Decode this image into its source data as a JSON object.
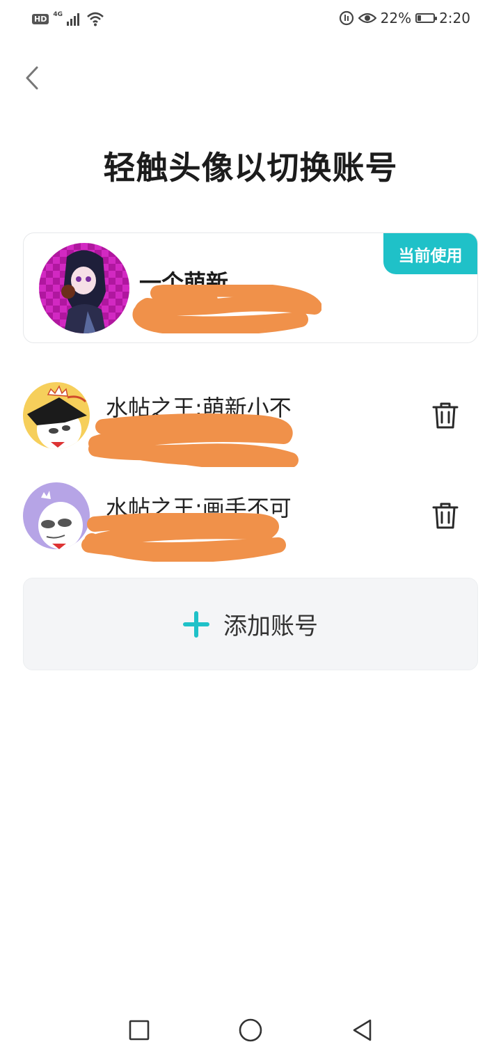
{
  "status_bar": {
    "hd_label": "HD",
    "network_label": "4G",
    "battery_text": "22%",
    "battery_level": 0.22,
    "time": "2:20"
  },
  "header": {
    "title": "轻触头像以切换账号"
  },
  "current_account": {
    "name": "一个萌新",
    "badge_label": "当前使用"
  },
  "accounts": [
    {
      "name": "水帖之王:萌新小不"
    },
    {
      "name": "水帖之王:画手不可"
    }
  ],
  "add_account": {
    "label": "添加账号"
  },
  "colors": {
    "accent": "#1fc1c8",
    "redaction": "#f0914a"
  },
  "icons": {
    "back": "chevron-left-icon",
    "delete": "trash-icon",
    "add": "plus-icon",
    "nav_recent": "square-icon",
    "nav_home": "circle-icon",
    "nav_back": "triangle-back-icon"
  }
}
